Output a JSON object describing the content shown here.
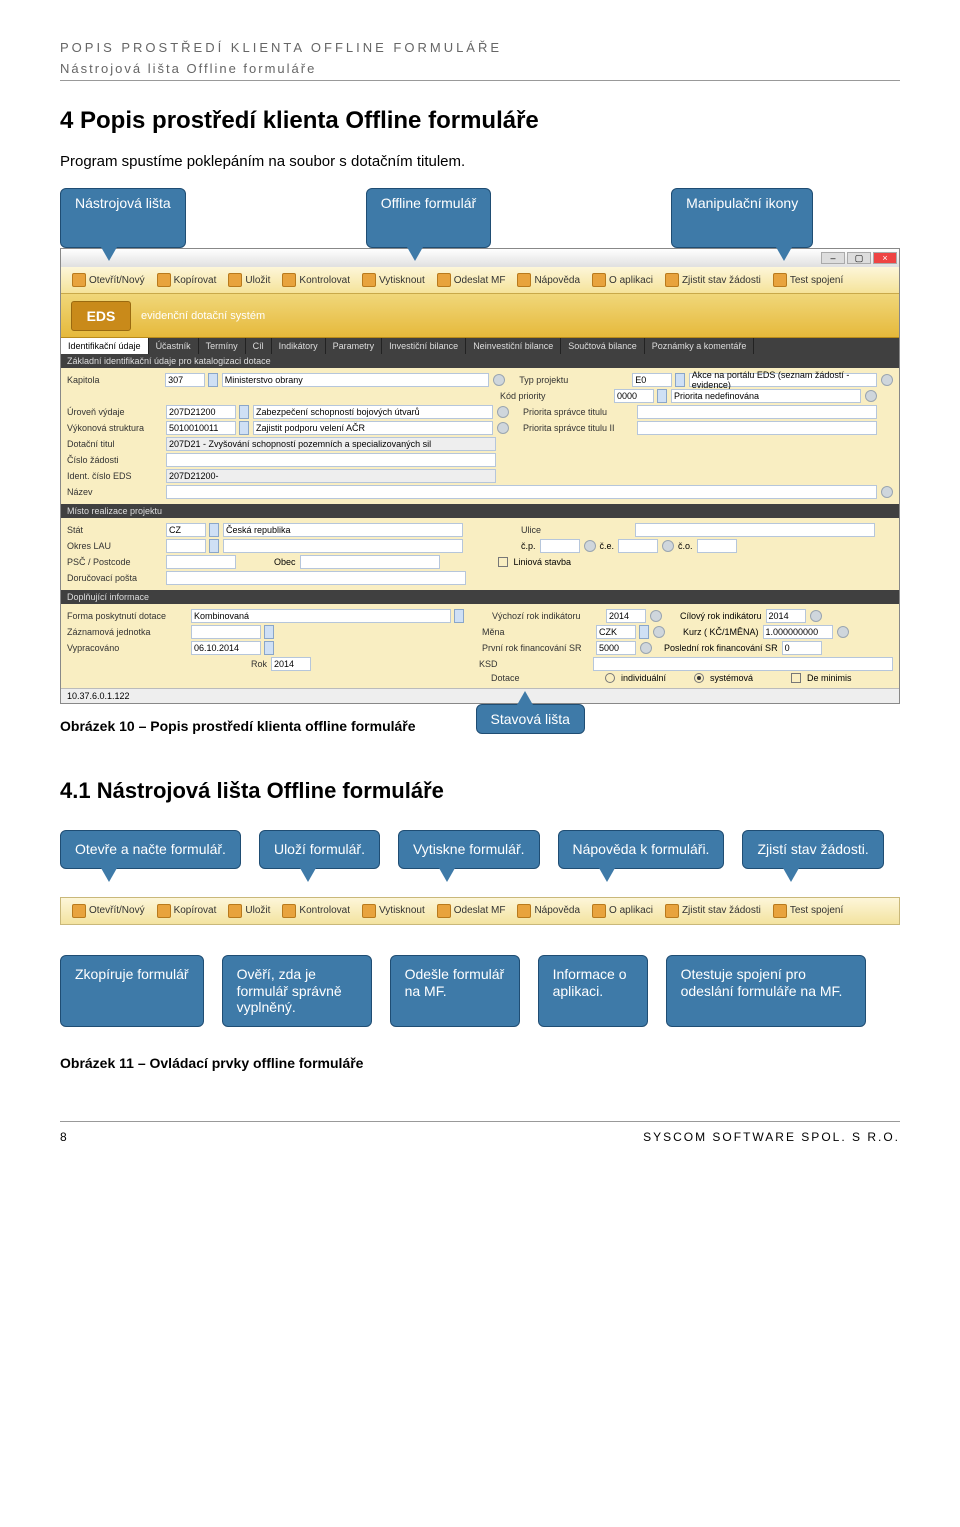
{
  "header": {
    "line1": "POPIS PROSTŘEDÍ KLIENTA OFFLINE FORMULÁŘE",
    "line2": "Nástrojová lišta Offline formuláře"
  },
  "section": {
    "title": "4   Popis prostředí klienta Offline formuláře",
    "intro": "Program spustíme poklepáním na soubor s dotačním titulem."
  },
  "callouts_top": {
    "toolbar": "Nástrojová lišta",
    "form": "Offline formulář",
    "icons": "Manipulační ikony"
  },
  "toolbar": {
    "open": "Otevřít/Nový",
    "copy": "Kopírovat",
    "save": "Uložit",
    "check": "Kontrolovat",
    "print": "Vytisknout",
    "send": "Odeslat MF",
    "help": "Nápověda",
    "about": "O aplikaci",
    "state": "Zjistit stav žádosti",
    "test": "Test spojení"
  },
  "banner": {
    "logo": "EDS",
    "subtitle": "evidenční dotační systém"
  },
  "tabs": [
    "Identifikační údaje",
    "Účastník",
    "Termíny",
    "Cíl",
    "Indikátory",
    "Parametry",
    "Investiční bilance",
    "Neinvestiční bilance",
    "Součtová bilance",
    "Poznámky a komentáře"
  ],
  "form": {
    "section_basic": "Základní identifikační údaje pro katalogizaci dotace",
    "kapitola_l": "Kapitola",
    "kapitola_v": "307",
    "kapitola_t": "Ministerstvo obrany",
    "typ_l": "Typ projektu",
    "typ_v": "E0",
    "typ_t": "Akce na portálu EDS (seznam žádostí - evidence)",
    "kod_l": "Kód priority",
    "kod_v": "0000",
    "kod_t": "Priorita nedefinována",
    "uroven_l": "Úroveň výdaje",
    "uroven_v": "207D21200",
    "uroven_t": "Zabezpečení schopností bojových útvarů",
    "priorita1_l": "Priorita správce titulu",
    "vykon_l": "Výkonová struktura",
    "vykon_v": "5010010011",
    "vykon_t": "Zajistit podporu velení AČR",
    "priorita2_l": "Priorita správce titulu II",
    "dotacni_l": "Dotační titul",
    "dotacni_t": "207D21 - Zvyšování schopností pozemních a specializovaných sil",
    "cislo_l": "Číslo žádosti",
    "ident_l": "Ident. číslo EDS",
    "ident_v": "207D21200-",
    "nazev_l": "Název",
    "section_misto": "Místo realizace projektu",
    "stat_l": "Stát",
    "stat_v": "CZ",
    "stat_t": "Česká republika",
    "ulice_l": "Ulice",
    "okres_l": "Okres LAU",
    "cp_l": "č.p.",
    "ce_l": "č.e.",
    "co_l": "č.o.",
    "psc_l": "PSČ / Postcode",
    "obec_l": "Obec",
    "liniova_l": "Liniová stavba",
    "posta_l": "Doručovací pošta",
    "section_dopln": "Doplňující informace",
    "forma_l": "Forma poskytnutí dotace",
    "forma_v": "Kombinovaná",
    "vychozi_l": "Výchozí rok indikátoru",
    "vychozi_v": "2014",
    "cilovy_l": "Cílový rok indikátoru",
    "cilovy_v": "2014",
    "zaznam_l": "Záznamová jednotka",
    "mena_l": "Měna",
    "mena_v": "CZK",
    "kurz_l": "Kurz ( KČ/1MĚNA)",
    "kurz_v": "1.000000000",
    "vyprac_l": "Vypracováno",
    "vyprac_v": "06.10.2014",
    "prvni_l": "První rok financování SR",
    "prvni_v": "5000",
    "posledni_l": "Poslední rok financování SR",
    "posledni_v": "0",
    "rok_l": "Rok",
    "rok_v": "2014",
    "ksd_l": "KSD",
    "dotace_l": "Dotace",
    "dotace_o1": "individuální",
    "dotace_o2": "systémová",
    "dotace_o3": "De minimis"
  },
  "statusbar": {
    "ip": "10.37.6.0.1.122"
  },
  "caption1_label": "Obrázek 10 – Popis prostředí klienta offline formuláře",
  "callout_status": "Stavová lišta",
  "subsection": "4.1     Nástrojová lišta Offline formuláře",
  "callouts2_top": {
    "open": "Otevře a načte formulář.",
    "save": "Uloží formulář.",
    "print": "Vytiskne formulář.",
    "help": "Nápověda k formuláři.",
    "state": "Zjistí stav žádosti."
  },
  "callouts2_bottom": {
    "copy": "Zkopíruje formulář",
    "check": "Ověří, zda je formulář správně vyplněný.",
    "send": "Odešle formulář na MF.",
    "about": "Informace o aplikaci.",
    "test": "Otestuje spojení pro odeslání formuláře na MF."
  },
  "caption2_label": "Obrázek 11 – Ovládací prvky offline formuláře",
  "footer": {
    "page": "8",
    "company": "SYSCOM SOFTWARE SPOL. S R.O."
  }
}
